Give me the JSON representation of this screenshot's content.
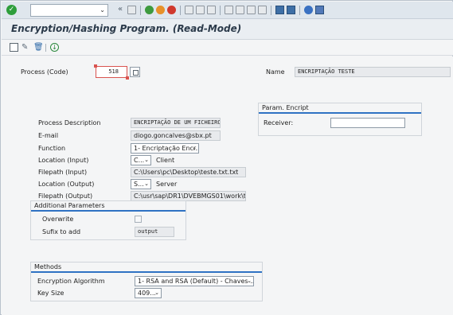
{
  "title": "Encryption/Hashing Program. (Read-Mode)",
  "process": {
    "code_label": "Process (Code)",
    "code_value": "518",
    "name_label": "Name",
    "name_value": "ENCRIPTAÇÃO TESTE"
  },
  "form": {
    "description_label": "Process Description",
    "description_value": "ENCRIPTAÇÃO DE UM FICHEIRO",
    "email_label": "E-mail",
    "email_value": "diogo.goncalves@sbx.pt",
    "function_label": "Function",
    "function_value": "1- Encriptação Encr...",
    "location_input_label": "Location (Input)",
    "location_input_value": "C...",
    "location_input_text": "Client",
    "filepath_input_label": "Filepath (Input)",
    "filepath_input_value": "C:\\Users\\pc\\Desktop\\teste.txt.txt",
    "location_output_label": "Location (Output)",
    "location_output_value": "S...",
    "location_output_text": "Server",
    "filepath_output_label": "Filepath (Output)",
    "filepath_output_value": "C:\\usr\\sap\\DR1\\DVEBMGS01\\work\\te..."
  },
  "additional": {
    "title": "Additional Parameters",
    "overwrite_label": "Overwrite",
    "suffix_label": "Sufix  to add",
    "suffix_value": "output"
  },
  "param": {
    "title": "Param. Encript",
    "receiver_label": "Receiver:",
    "receiver_value": ""
  },
  "methods": {
    "title": "Methods",
    "algorithm_label": "Encryption Algorithm",
    "algorithm_value": "1- RSA and RSA (Default) - Chaves ...",
    "keysize_label": "Key Size",
    "keysize_value": "409..."
  },
  "icons": {
    "ok": "checkmark-icon",
    "dropdown_arrow": "chevron-down-icon",
    "back": "double-chevron-left-icon"
  }
}
